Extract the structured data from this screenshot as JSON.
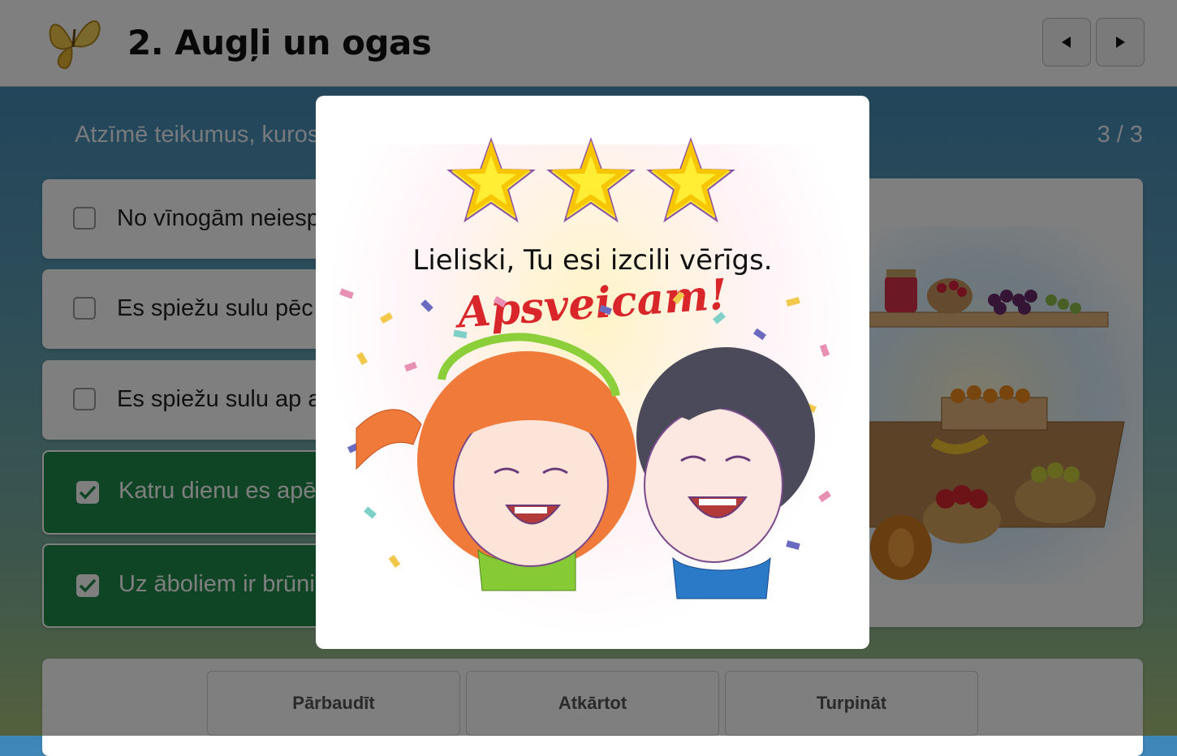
{
  "header": {
    "title": "2. Augļi un ogas",
    "prev_label": "◀",
    "next_label": "▶"
  },
  "task": {
    "instruction": "Atzīmē teikumus, kuros",
    "counter": "3 / 3"
  },
  "options": [
    {
      "text": "No vīnogām neiesp",
      "checked": false
    },
    {
      "text": "Es spiežu sulu pēc",
      "checked": false
    },
    {
      "text": "Es spiežu sulu ap a",
      "checked": false
    },
    {
      "text": "Katru dienu es apē",
      "checked": true
    },
    {
      "text": "Uz āboliem ir brūni",
      "checked": true
    }
  ],
  "actions": {
    "check": "Pārbaudīt",
    "retry": "Atkārtot",
    "continue": "Turpināt"
  },
  "result": {
    "stars": 3,
    "message": "Lieliski, Tu esi izcili vērīgs.",
    "congrats": "Apsveicam!"
  },
  "colors": {
    "checked_bg": "#1f8a4a",
    "star_fill": "#ffee33",
    "star_stroke": "#8b4fa8",
    "congrats": "#d8262a"
  }
}
